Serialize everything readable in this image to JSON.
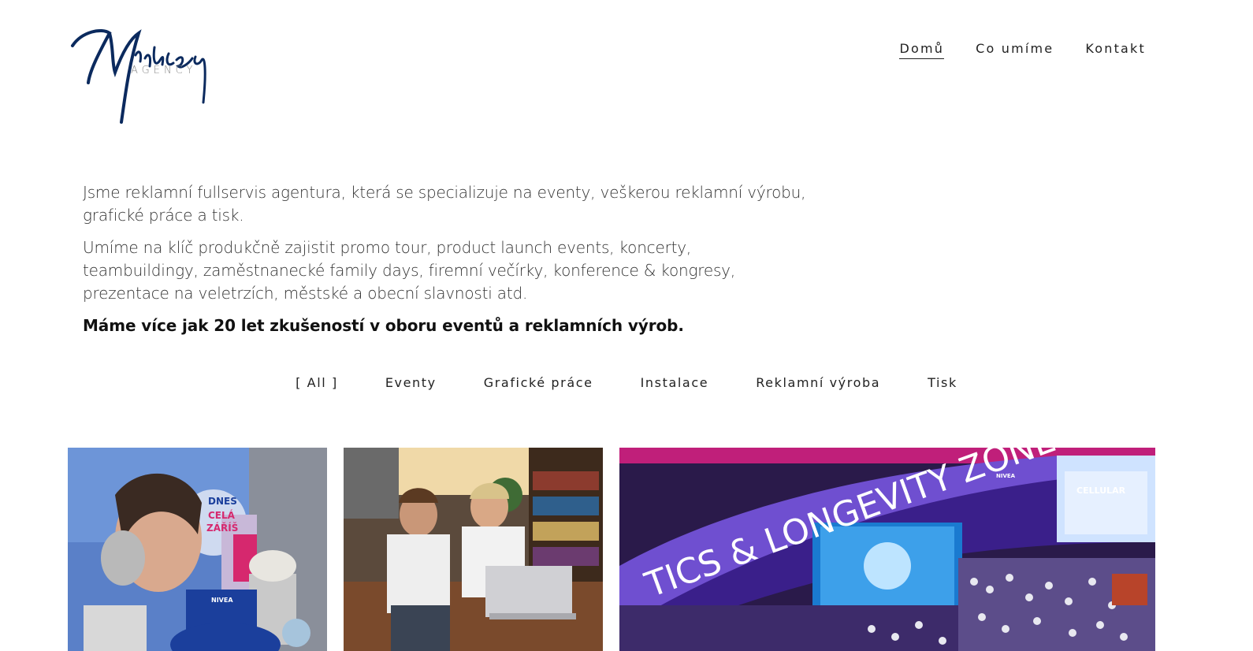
{
  "header": {
    "logo_script": "Mikulecky",
    "logo_sub": "AGENCY",
    "nav": [
      {
        "label": "Domů",
        "active": true
      },
      {
        "label": "Co umíme",
        "active": false
      },
      {
        "label": "Kontakt",
        "active": false
      }
    ]
  },
  "intro": {
    "p1": "Jsme reklamní fullservis agentura, která se specializuje na eventy, veškerou reklamní výrobu, grafické práce a tisk.",
    "p2": "Umíme na klíč produkčně zajistit promo tour, product launch events, koncerty, teambuildingy, zaměstnanecké family days, firemní večírky, konference & kongresy, prezentace na veletrzích, městské a obecní slavnosti atd.",
    "p3": "Máme více jak 20 let zkušeností v oboru eventů a reklamních výrob."
  },
  "filters": [
    "[ All ]",
    "Eventy",
    "Grafické práce",
    "Instalace",
    "Reklamní výroba",
    "Tisk"
  ],
  "gallery": {
    "tiles": [
      {
        "name": "nivea-promo-stand",
        "texts": [
          "DNES",
          "CELÁ",
          "ZÁŘÍŠ",
          "NIVEA"
        ]
      },
      {
        "name": "talk-show-event",
        "texts": []
      },
      {
        "name": "longevity-zone-event",
        "texts": [
          "TICS & LONGEVITY ZONE",
          "CELLULAR",
          "NIVEA"
        ]
      }
    ]
  },
  "colors": {
    "logo_blue": "#0b2a5e",
    "text": "#333333",
    "nivea_blue": "#1b3f9c",
    "event_purple": "#5b2fa8"
  }
}
